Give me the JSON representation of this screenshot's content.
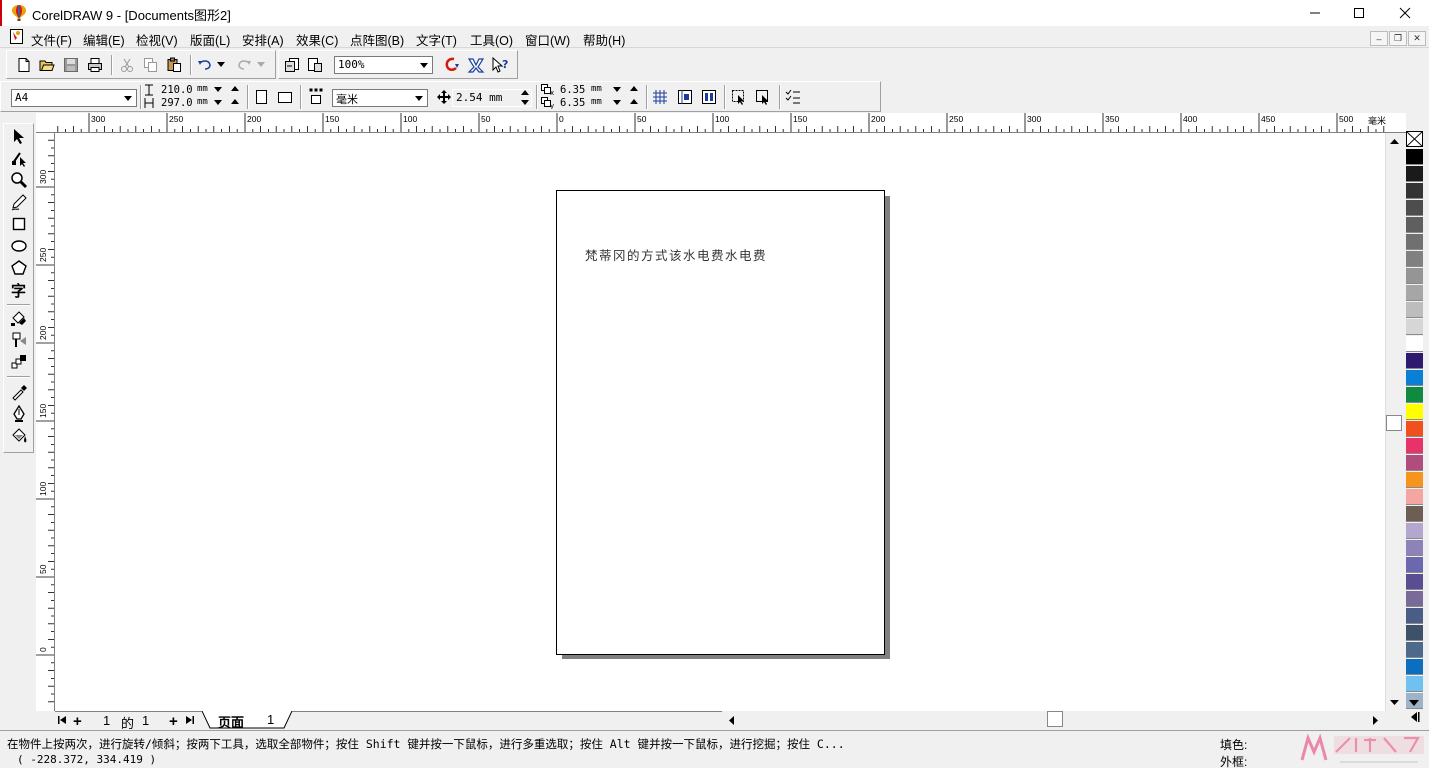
{
  "window": {
    "title": "CorelDRAW 9 - [Documents图形2]"
  },
  "menu": {
    "items": [
      "文件(F)",
      "编辑(E)",
      "检视(V)",
      "版面(L)",
      "安排(A)",
      "效果(C)",
      "点阵图(B)",
      "文字(T)",
      "工具(O)",
      "窗口(W)",
      "帮助(H)"
    ]
  },
  "toolbar": {
    "zoom": "100%"
  },
  "property_bar": {
    "paper_size": "A4",
    "width": "210.0",
    "height": "297.0",
    "size_unit": "mm",
    "units": "毫米",
    "nudge": "2.54 mm",
    "duplicate_x": "6.35",
    "duplicate_y": "6.35",
    "duplicate_unit": "mm"
  },
  "ruler": {
    "unit_label": "毫米",
    "h_labels": [
      "300",
      "250",
      "200",
      "150",
      "100",
      "50",
      "0",
      "50",
      "100",
      "150",
      "200",
      "250",
      "300",
      "350",
      "400",
      "450",
      "500"
    ],
    "v_labels": [
      "300",
      "250",
      "200",
      "150",
      "100",
      "50",
      "0"
    ]
  },
  "document": {
    "text": "梵蒂冈的方式该水电费水电费"
  },
  "page_nav": {
    "current": "1",
    "of_label": "的",
    "total": "1",
    "tab_label": "页面",
    "tab_number": "1"
  },
  "palette": {
    "colors": [
      "#000000",
      "#1a1a1a",
      "#333333",
      "#4d4d4d",
      "#5f5f5f",
      "#707070",
      "#808080",
      "#959595",
      "#a6a6a6",
      "#bdbdbd",
      "#d6d6d6",
      "#ffffff",
      "#2e1a6e",
      "#0a7fd6",
      "#0f8a3f",
      "#ffff00",
      "#f0501e",
      "#e8336a",
      "#b04d7e",
      "#f7941d",
      "#f4a7a0",
      "#6d5d52",
      "#b3a6cf",
      "#8e83b8",
      "#6c68b0",
      "#5a4d92",
      "#7a6a9a",
      "#4b5d87",
      "#3e5168",
      "#4d6a8c",
      "#0a6fbf",
      "#6fc2ef",
      "#9fb3c8"
    ]
  },
  "status": {
    "hint": "在物件上按两次，进行旋转/倾斜；按两下工具，选取全部物件；按住 Shift 键并按一下鼠标，进行多重选取；按住 Alt 键并按一下鼠标，进行挖掘；按住 C...",
    "coords": "( -228.372, 334.419 )",
    "fill_label": "填色:",
    "outline_label": "外框:"
  }
}
